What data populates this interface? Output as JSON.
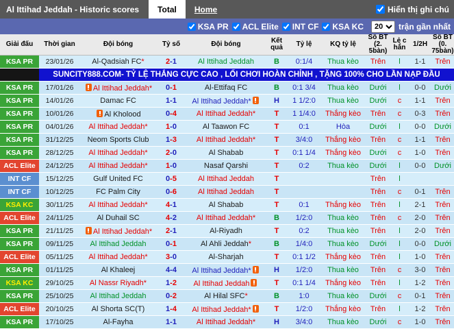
{
  "topbar": {
    "title": "Al Ittihad Jeddah - Historic scores",
    "tabs": [
      {
        "label": "Total",
        "active": true
      },
      {
        "label": "Home",
        "active": false
      }
    ],
    "note_toggle": {
      "label": "Hiển thị ghi chú",
      "checked": true
    }
  },
  "filterbar": {
    "leagues": [
      {
        "label": "KSA PR",
        "checked": true
      },
      {
        "label": "ACL Elite",
        "checked": true
      },
      {
        "label": "INT CF",
        "checked": true
      },
      {
        "label": "KSA KC",
        "checked": true
      }
    ],
    "count_select": {
      "value": "20"
    },
    "count_suffix": "trận gần nhất"
  },
  "table": {
    "headers": [
      "Giải đấu",
      "Thời gian",
      "Đội bóng",
      "Tỷ số",
      "Đội bóng",
      "Kết\nquả",
      "Tỷ lệ",
      "KQ tỷ lệ",
      "Số BT (2.\n5bàn)",
      "Lẻ c\nhẳn",
      "1/2H",
      "Số BT (0.\n75bàn)"
    ],
    "banner": {
      "text": "SUNCITY888.COM- TỶ LỆ THẮNG CỰC CAO , LỐI CHƠI HOÀN CHỈNH , TẶNG 100% CHO LẦN NẠP ĐẦU"
    },
    "banner_after_row": 0,
    "league_styles": {
      "KSA PR": {
        "bg": "#3aa437",
        "fg": "#ffffff"
      },
      "ACL Elite": {
        "bg": "#e2452f",
        "fg": "#ffffff"
      },
      "INT CF": {
        "bg": "#5b8fd0",
        "fg": "#ffffff"
      },
      "KSA KC": {
        "bg": "#3aa437",
        "fg": "#ffee00"
      }
    },
    "colors": {
      "red": "#e60000",
      "blue": "#2121bb",
      "green": "#009127",
      "black": "#1a1a1a"
    },
    "rows": [
      {
        "league": "KSA PR",
        "date": "23/01/26",
        "home": {
          "name": "Al-Qadsiah FC*",
          "color": "black"
        },
        "score": {
          "h": "2",
          "a": "1",
          "hc": "red",
          "ac": "blue"
        },
        "away": {
          "name": "Al Ittihad Jeddah",
          "color": "green"
        },
        "result": {
          "text": "B",
          "color": "green"
        },
        "odds": "0:1/4",
        "kq": {
          "text": "Thua kèo",
          "color": "green"
        },
        "bt25": {
          "text": "Trên",
          "color": "red"
        },
        "oe": {
          "text": "l",
          "color": "green"
        },
        "half": "1-1",
        "bt075": {
          "text": "Trên",
          "color": "red"
        }
      },
      {
        "league": "KSA PR",
        "date": "17/01/26",
        "home": {
          "name": "Al Ittihad Jeddah*",
          "color": "red",
          "icon": "before"
        },
        "score": {
          "h": "0",
          "a": "1",
          "hc": "blue",
          "ac": "red"
        },
        "away": {
          "name": "Al-Ettifaq FC",
          "color": "black"
        },
        "result": {
          "text": "B",
          "color": "green"
        },
        "odds": "0:1 3/4",
        "kq": {
          "text": "Thua kèo",
          "color": "green"
        },
        "bt25": {
          "text": "Dưới",
          "color": "green"
        },
        "oe": {
          "text": "l",
          "color": "green"
        },
        "half": "0-0",
        "bt075": {
          "text": "Dưới",
          "color": "green"
        }
      },
      {
        "league": "KSA PR",
        "date": "14/01/26",
        "home": {
          "name": "Damac FC",
          "color": "black"
        },
        "score": {
          "h": "1",
          "a": "1",
          "hc": "blue",
          "ac": "blue"
        },
        "away": {
          "name": "Al Ittihad Jeddah*",
          "color": "blue",
          "icon": "after"
        },
        "result": {
          "text": "H",
          "color": "blue"
        },
        "odds": "1 1/2:0",
        "kq": {
          "text": "Thua kèo",
          "color": "green"
        },
        "bt25": {
          "text": "Dưới",
          "color": "green"
        },
        "oe": {
          "text": "c",
          "color": "red"
        },
        "half": "1-1",
        "bt075": {
          "text": "Trên",
          "color": "red"
        }
      },
      {
        "league": "KSA PR",
        "date": "10/01/26",
        "home": {
          "name": "Al Kholood",
          "color": "black",
          "icon": "before"
        },
        "score": {
          "h": "0",
          "a": "4",
          "hc": "blue",
          "ac": "red"
        },
        "away": {
          "name": "Al Ittihad Jeddah*",
          "color": "red"
        },
        "result": {
          "text": "T",
          "color": "red"
        },
        "odds": "1 1/4:0",
        "kq": {
          "text": "Thắng kèo",
          "color": "red"
        },
        "bt25": {
          "text": "Trên",
          "color": "red"
        },
        "oe": {
          "text": "c",
          "color": "red"
        },
        "half": "0-3",
        "bt075": {
          "text": "Trên",
          "color": "red"
        }
      },
      {
        "league": "KSA PR",
        "date": "04/01/26",
        "home": {
          "name": "Al Ittihad Jeddah*",
          "color": "red"
        },
        "score": {
          "h": "1",
          "a": "0",
          "hc": "red",
          "ac": "blue"
        },
        "away": {
          "name": "Al Taawon FC",
          "color": "black"
        },
        "result": {
          "text": "T",
          "color": "red"
        },
        "odds": "0:1",
        "kq": {
          "text": "Hòa",
          "color": "blue"
        },
        "bt25": {
          "text": "Dưới",
          "color": "green"
        },
        "oe": {
          "text": "l",
          "color": "green"
        },
        "half": "0-0",
        "bt075": {
          "text": "Dưới",
          "color": "green"
        }
      },
      {
        "league": "KSA PR",
        "date": "31/12/25",
        "home": {
          "name": "Neom Sports Club",
          "color": "black"
        },
        "score": {
          "h": "1",
          "a": "3",
          "hc": "blue",
          "ac": "red"
        },
        "away": {
          "name": "Al Ittihad Jeddah*",
          "color": "red"
        },
        "result": {
          "text": "T",
          "color": "red"
        },
        "odds": "3/4:0",
        "kq": {
          "text": "Thắng kèo",
          "color": "red"
        },
        "bt25": {
          "text": "Trên",
          "color": "red"
        },
        "oe": {
          "text": "c",
          "color": "red"
        },
        "half": "1-1",
        "bt075": {
          "text": "Trên",
          "color": "red"
        }
      },
      {
        "league": "KSA PR",
        "date": "28/12/25",
        "home": {
          "name": "Al Ittihad Jeddah*",
          "color": "red"
        },
        "score": {
          "h": "2",
          "a": "0",
          "hc": "red",
          "ac": "blue"
        },
        "away": {
          "name": "Al Shabab",
          "color": "black"
        },
        "result": {
          "text": "T",
          "color": "red"
        },
        "odds": "0:1 1/4",
        "kq": {
          "text": "Thắng kèo",
          "color": "red"
        },
        "bt25": {
          "text": "Dưới",
          "color": "green"
        },
        "oe": {
          "text": "c",
          "color": "red"
        },
        "half": "1-0",
        "bt075": {
          "text": "Trên",
          "color": "red"
        }
      },
      {
        "league": "ACL Elite",
        "date": "24/12/25",
        "home": {
          "name": "Al Ittihad Jeddah*",
          "color": "red"
        },
        "score": {
          "h": "1",
          "a": "0",
          "hc": "red",
          "ac": "blue"
        },
        "away": {
          "name": "Nasaf Qarshi",
          "color": "black"
        },
        "result": {
          "text": "T",
          "color": "red"
        },
        "odds": "0:2",
        "kq": {
          "text": "Thua kèo",
          "color": "green"
        },
        "bt25": {
          "text": "Dưới",
          "color": "green"
        },
        "oe": {
          "text": "l",
          "color": "green"
        },
        "half": "0-0",
        "bt075": {
          "text": "Dưới",
          "color": "green"
        }
      },
      {
        "league": "INT CF",
        "date": "15/12/25",
        "home": {
          "name": "Gulf United FC",
          "color": "black"
        },
        "score": {
          "h": "0",
          "a": "5",
          "hc": "blue",
          "ac": "red"
        },
        "away": {
          "name": "Al Ittihad Jeddah",
          "color": "red"
        },
        "result": {
          "text": "T",
          "color": "red"
        },
        "odds": "",
        "kq": {
          "text": "",
          "color": "black"
        },
        "bt25": {
          "text": "Trên",
          "color": "red"
        },
        "oe": {
          "text": "l",
          "color": "green"
        },
        "half": "",
        "bt075": {
          "text": "",
          "color": "black"
        }
      },
      {
        "league": "INT CF",
        "date": "10/12/25",
        "home": {
          "name": "FC Palm City",
          "color": "black"
        },
        "score": {
          "h": "0",
          "a": "6",
          "hc": "blue",
          "ac": "red"
        },
        "away": {
          "name": "Al Ittihad Jeddah",
          "color": "red"
        },
        "result": {
          "text": "T",
          "color": "red"
        },
        "odds": "",
        "kq": {
          "text": "",
          "color": "black"
        },
        "bt25": {
          "text": "Trên",
          "color": "red"
        },
        "oe": {
          "text": "c",
          "color": "red"
        },
        "half": "0-1",
        "bt075": {
          "text": "Trên",
          "color": "red"
        }
      },
      {
        "league": "KSA KC",
        "date": "30/11/25",
        "home": {
          "name": "Al Ittihad Jeddah*",
          "color": "red"
        },
        "score": {
          "h": "4",
          "a": "1",
          "hc": "red",
          "ac": "blue"
        },
        "away": {
          "name": "Al Shabab",
          "color": "black"
        },
        "result": {
          "text": "T",
          "color": "red"
        },
        "odds": "0:1",
        "kq": {
          "text": "Thắng kèo",
          "color": "red"
        },
        "bt25": {
          "text": "Trên",
          "color": "red"
        },
        "oe": {
          "text": "l",
          "color": "green"
        },
        "half": "2-1",
        "bt075": {
          "text": "Trên",
          "color": "red"
        }
      },
      {
        "league": "ACL Elite",
        "date": "24/11/25",
        "home": {
          "name": "Al Duhail SC",
          "color": "black"
        },
        "score": {
          "h": "4",
          "a": "2",
          "hc": "red",
          "ac": "blue"
        },
        "away": {
          "name": "Al Ittihad Jeddah*",
          "color": "red"
        },
        "result": {
          "text": "B",
          "color": "green"
        },
        "odds": "1/2:0",
        "kq": {
          "text": "Thua kèo",
          "color": "green"
        },
        "bt25": {
          "text": "Trên",
          "color": "red"
        },
        "oe": {
          "text": "c",
          "color": "red"
        },
        "half": "2-0",
        "bt075": {
          "text": "Trên",
          "color": "red"
        }
      },
      {
        "league": "KSA PR",
        "date": "21/11/25",
        "home": {
          "name": "Al Ittihad Jeddah*",
          "color": "red",
          "icon": "before"
        },
        "score": {
          "h": "2",
          "a": "1",
          "hc": "red",
          "ac": "blue"
        },
        "away": {
          "name": "Al-Riyadh",
          "color": "black"
        },
        "result": {
          "text": "T",
          "color": "red"
        },
        "odds": "0:2",
        "kq": {
          "text": "Thua kèo",
          "color": "green"
        },
        "bt25": {
          "text": "Trên",
          "color": "red"
        },
        "oe": {
          "text": "l",
          "color": "green"
        },
        "half": "2-0",
        "bt075": {
          "text": "Trên",
          "color": "red"
        }
      },
      {
        "league": "KSA PR",
        "date": "09/11/25",
        "home": {
          "name": "Al Ittihad Jeddah",
          "color": "green"
        },
        "score": {
          "h": "0",
          "a": "1",
          "hc": "blue",
          "ac": "red"
        },
        "away": {
          "name": "Al Ahli Jeddah*",
          "color": "black"
        },
        "result": {
          "text": "B",
          "color": "green"
        },
        "odds": "1/4:0",
        "kq": {
          "text": "Thua kèo",
          "color": "green"
        },
        "bt25": {
          "text": "Dưới",
          "color": "green"
        },
        "oe": {
          "text": "l",
          "color": "green"
        },
        "half": "0-0",
        "bt075": {
          "text": "Dưới",
          "color": "green"
        }
      },
      {
        "league": "ACL Elite",
        "date": "05/11/25",
        "home": {
          "name": "Al Ittihad Jeddah*",
          "color": "red"
        },
        "score": {
          "h": "3",
          "a": "0",
          "hc": "red",
          "ac": "blue"
        },
        "away": {
          "name": "Al-Sharjah",
          "color": "black"
        },
        "result": {
          "text": "T",
          "color": "red"
        },
        "odds": "0:1 1/2",
        "kq": {
          "text": "Thắng kèo",
          "color": "red"
        },
        "bt25": {
          "text": "Trên",
          "color": "red"
        },
        "oe": {
          "text": "l",
          "color": "green"
        },
        "half": "1-0",
        "bt075": {
          "text": "Trên",
          "color": "red"
        }
      },
      {
        "league": "KSA PR",
        "date": "01/11/25",
        "home": {
          "name": "Al Khaleej",
          "color": "black"
        },
        "score": {
          "h": "4",
          "a": "4",
          "hc": "blue",
          "ac": "blue"
        },
        "away": {
          "name": "Al Ittihad Jeddah*",
          "color": "blue",
          "icon": "after"
        },
        "result": {
          "text": "H",
          "color": "blue"
        },
        "odds": "1/2:0",
        "kq": {
          "text": "Thua kèo",
          "color": "green"
        },
        "bt25": {
          "text": "Trên",
          "color": "red"
        },
        "oe": {
          "text": "c",
          "color": "red"
        },
        "half": "3-0",
        "bt075": {
          "text": "Trên",
          "color": "red"
        }
      },
      {
        "league": "KSA KC",
        "date": "29/10/25",
        "home": {
          "name": "Al Nassr Riyadh*",
          "color": "red"
        },
        "score": {
          "h": "1",
          "a": "2",
          "hc": "blue",
          "ac": "red"
        },
        "away": {
          "name": "Al Ittihad Jeddah",
          "color": "red",
          "icon": "after"
        },
        "result": {
          "text": "T",
          "color": "red"
        },
        "odds": "0:1 1/4",
        "kq": {
          "text": "Thắng kèo",
          "color": "red"
        },
        "bt25": {
          "text": "Trên",
          "color": "red"
        },
        "oe": {
          "text": "l",
          "color": "green"
        },
        "half": "1-2",
        "bt075": {
          "text": "Trên",
          "color": "red"
        }
      },
      {
        "league": "KSA PR",
        "date": "25/10/25",
        "home": {
          "name": "Al Ittihad Jeddah",
          "color": "green"
        },
        "score": {
          "h": "0",
          "a": "2",
          "hc": "blue",
          "ac": "red"
        },
        "away": {
          "name": "Al Hilal SFC*",
          "color": "black"
        },
        "result": {
          "text": "B",
          "color": "green"
        },
        "odds": "1:0",
        "kq": {
          "text": "Thua kèo",
          "color": "green"
        },
        "bt25": {
          "text": "Dưới",
          "color": "green"
        },
        "oe": {
          "text": "c",
          "color": "red"
        },
        "half": "0-1",
        "bt075": {
          "text": "Trên",
          "color": "red"
        }
      },
      {
        "league": "ACL Elite",
        "date": "20/10/25",
        "home": {
          "name": "Al Shorta SC(T)",
          "color": "black"
        },
        "score": {
          "h": "1",
          "a": "4",
          "hc": "blue",
          "ac": "red"
        },
        "away": {
          "name": "Al Ittihad Jeddah*",
          "color": "red",
          "icon": "after"
        },
        "result": {
          "text": "T",
          "color": "red"
        },
        "odds": "1/2:0",
        "kq": {
          "text": "Thắng kèo",
          "color": "red"
        },
        "bt25": {
          "text": "Trên",
          "color": "red"
        },
        "oe": {
          "text": "l",
          "color": "green"
        },
        "half": "1-2",
        "bt075": {
          "text": "Trên",
          "color": "red"
        }
      },
      {
        "league": "KSA PR",
        "date": "17/10/25",
        "home": {
          "name": "Al-Fayha",
          "color": "black"
        },
        "score": {
          "h": "1",
          "a": "1",
          "hc": "blue",
          "ac": "blue"
        },
        "away": {
          "name": "Al Ittihad Jeddah*",
          "color": "red"
        },
        "result": {
          "text": "H",
          "color": "blue"
        },
        "odds": "3/4:0",
        "kq": {
          "text": "Thua kèo",
          "color": "green"
        },
        "bt25": {
          "text": "Dưới",
          "color": "green"
        },
        "oe": {
          "text": "c",
          "color": "red"
        },
        "half": "1-0",
        "bt075": {
          "text": "Trên",
          "color": "red"
        }
      }
    ]
  }
}
